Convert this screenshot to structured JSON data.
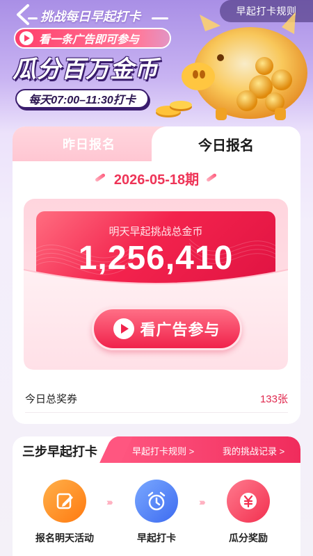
{
  "header": {
    "title": "挑战每日早起打卡",
    "rules_button": "早起打卡规则",
    "ad_hint": "看一条广告即可参与",
    "big_title": "瓜分百万金币",
    "time_range": "每天07:00–11:30打卡"
  },
  "tabs": {
    "yesterday": "昨日报名",
    "today": "今日报名"
  },
  "period": "2026-05-18期",
  "pool": {
    "label": "明天早起挑战总金币",
    "amount": "1,256,410"
  },
  "watch_ad_button": "看广告参与",
  "voucher": {
    "label": "今日总奖券",
    "count": "133张"
  },
  "steps": {
    "title": "三步早起打卡",
    "rules_link": "早起打卡规则 >",
    "record_link": "我的挑战记录 >",
    "items": [
      {
        "label": "报名明天活动",
        "icon": "edit-icon",
        "color": "#ff8a1f"
      },
      {
        "label": "早起打卡",
        "icon": "alarm-clock-icon",
        "color": "#4f7ff7"
      },
      {
        "label": "瓜分奖励",
        "icon": "yuan-coin-icon",
        "color": "#ff4466"
      }
    ]
  },
  "colors": {
    "accent": "#ee3457",
    "brand_purple": "#3a1d6d"
  }
}
